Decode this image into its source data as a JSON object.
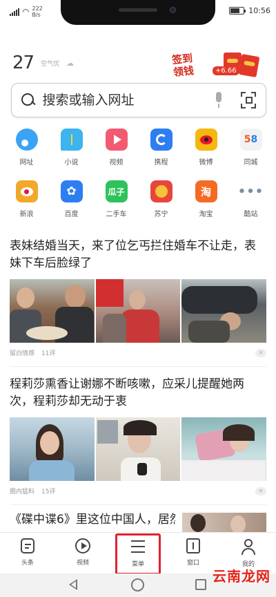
{
  "status_bar": {
    "network_speed": "222\nB/s",
    "time": "10:56"
  },
  "weather": {
    "temperature": "27",
    "condition": "空气优"
  },
  "promo": {
    "text": "签到领钱",
    "badge": "+6.66"
  },
  "search": {
    "placeholder": "搜索或输入网址"
  },
  "shortcuts": [
    {
      "label": "网址",
      "icon": "circle-dot-icon",
      "color": "#3ba3f5"
    },
    {
      "label": "小说",
      "icon": "speech-bubble-icon",
      "color": "#3bb4f0"
    },
    {
      "label": "视频",
      "icon": "play-icon",
      "color": "#f25a72"
    },
    {
      "label": "携程",
      "icon": "refresh-c-icon",
      "color": "#2e7ef2"
    },
    {
      "label": "微博",
      "icon": "weibo-eye-icon",
      "color": "#f5b80f"
    },
    {
      "label": "同城",
      "icon": "58-icon",
      "color": "#f2f2f2"
    },
    {
      "label": "新浪",
      "icon": "sina-eye-icon",
      "color": "#f2a829"
    },
    {
      "label": "百度",
      "icon": "paw-icon",
      "color": "#2e7ef2"
    },
    {
      "label": "二手车",
      "icon": "guazi-icon",
      "color": "#2fc25b"
    },
    {
      "label": "苏宁",
      "icon": "lion-icon",
      "color": "#e6473a"
    },
    {
      "label": "淘宝",
      "icon": "tao-icon",
      "color": "#f56b24"
    },
    {
      "label": "酷站",
      "icon": "more-dots-icon",
      "color": "#ffffff"
    }
  ],
  "news": [
    {
      "title": "表妹结婚当天，来了位乞丐拦住婚车不让走，表妹下车后脸绿了",
      "source": "留白情感",
      "comments": "11评"
    },
    {
      "title": "程莉莎熏香让谢娜不断咳嗽，应采儿提醒她两次，程莉莎却无动于衷",
      "source": "圈内猛料",
      "comments": "15评"
    },
    {
      "title": "《碟中谍6》里这位中国人，居然"
    }
  ],
  "bottom_nav": [
    {
      "label": "头条"
    },
    {
      "label": "视频"
    },
    {
      "label": "菜单"
    },
    {
      "label": "窗口"
    },
    {
      "label": "我的"
    }
  ],
  "watermark": "云南龙网"
}
